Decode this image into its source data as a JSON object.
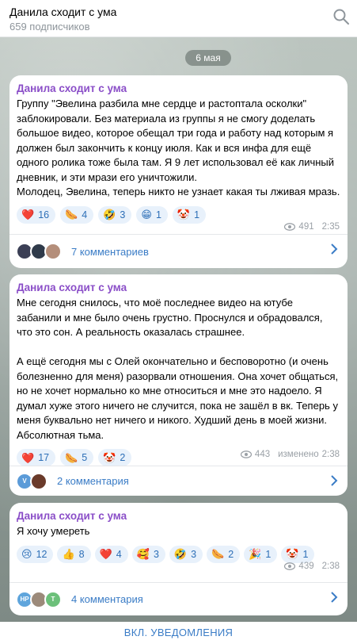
{
  "header": {
    "title": "Данила сходит с ума",
    "subtitle": "659 подписчиков"
  },
  "date_label": "6 мая",
  "posts": [
    {
      "author": "Данила сходит с ума",
      "text": "Группу \"Эвелина разбила мне сердце и растоптала осколки\" заблокировали. Без материала из группы я не смогу доделать большое видео, которое обещал три года и работу над которым я должен был закончить к концу июля. Как и вся инфа для ещё одного ролика тоже была там. Я 9 лет использовал её как личный дневник, и эти мрази его уничтожили.\nМолодец, Эвелина, теперь никто не узнает какая ты лживая мразь.",
      "reactions": [
        {
          "emoji": "❤️",
          "count": "16"
        },
        {
          "emoji": "🌭",
          "count": "4"
        },
        {
          "emoji": "🤣",
          "count": "3"
        },
        {
          "emoji": "😁",
          "count": "1"
        },
        {
          "emoji": "🤡",
          "count": "1"
        }
      ],
      "views": "491",
      "edited": "",
      "time": "2:35",
      "comments_label": "7 комментариев",
      "avatars": [
        {
          "initials": "",
          "color": "#3b3f55"
        },
        {
          "initials": "",
          "color": "#2f3a4a"
        },
        {
          "initials": "",
          "color": "#b48e7a"
        }
      ]
    },
    {
      "author": "Данила сходит с ума",
      "text": "Мне сегодня снилось, что моё последнее видео на ютубе забанили и мне было очень грустно. Проснулся и обрадовался, что это сон. А реальность оказалась страшнее.\n\nА ещё сегодня мы с Олей окончательно и бесповоротно (и очень болезненно для меня) разорвали отношения. Она хочет общаться, но не хочет нормально ко мне относиться и мне это надоело. Я думал хуже этого ничего не случится, пока не зашёл в вк. Теперь у меня буквально нет ничего и никого. Худший день в моей жизни. Абсолютная тьма.",
      "reactions": [
        {
          "emoji": "❤️",
          "count": "17"
        },
        {
          "emoji": "🌭",
          "count": "5"
        },
        {
          "emoji": "🤡",
          "count": "2"
        }
      ],
      "views": "443",
      "edited": "изменено",
      "time": "2:38",
      "comments_label": "2 комментария",
      "avatars": [
        {
          "initials": "V",
          "color": "#5b9bd8"
        },
        {
          "initials": "",
          "color": "#6a3a2a"
        }
      ]
    },
    {
      "author": "Данила сходит с ума",
      "text": "Я хочу умереть",
      "reactions": [
        {
          "emoji": "😢",
          "count": "12"
        },
        {
          "emoji": "👍",
          "count": "8"
        },
        {
          "emoji": "❤️",
          "count": "4"
        },
        {
          "emoji": "🥰",
          "count": "3"
        },
        {
          "emoji": "🤣",
          "count": "3"
        },
        {
          "emoji": "🌭",
          "count": "2"
        },
        {
          "emoji": "🎉",
          "count": "1"
        },
        {
          "emoji": "🤡",
          "count": "1"
        }
      ],
      "views": "439",
      "edited": "",
      "time": "2:38",
      "comments_label": "4 комментария",
      "avatars": [
        {
          "initials": "HP",
          "color": "#5fa5dc"
        },
        {
          "initials": "",
          "color": "#9c8a7a"
        },
        {
          "initials": "T",
          "color": "#6cc07a"
        }
      ]
    }
  ],
  "footer": {
    "label": "ВКЛ. УВЕДОМЛЕНИЯ"
  },
  "colors": {
    "accent": "#3a7cc6",
    "author": "#8b4fc8"
  }
}
